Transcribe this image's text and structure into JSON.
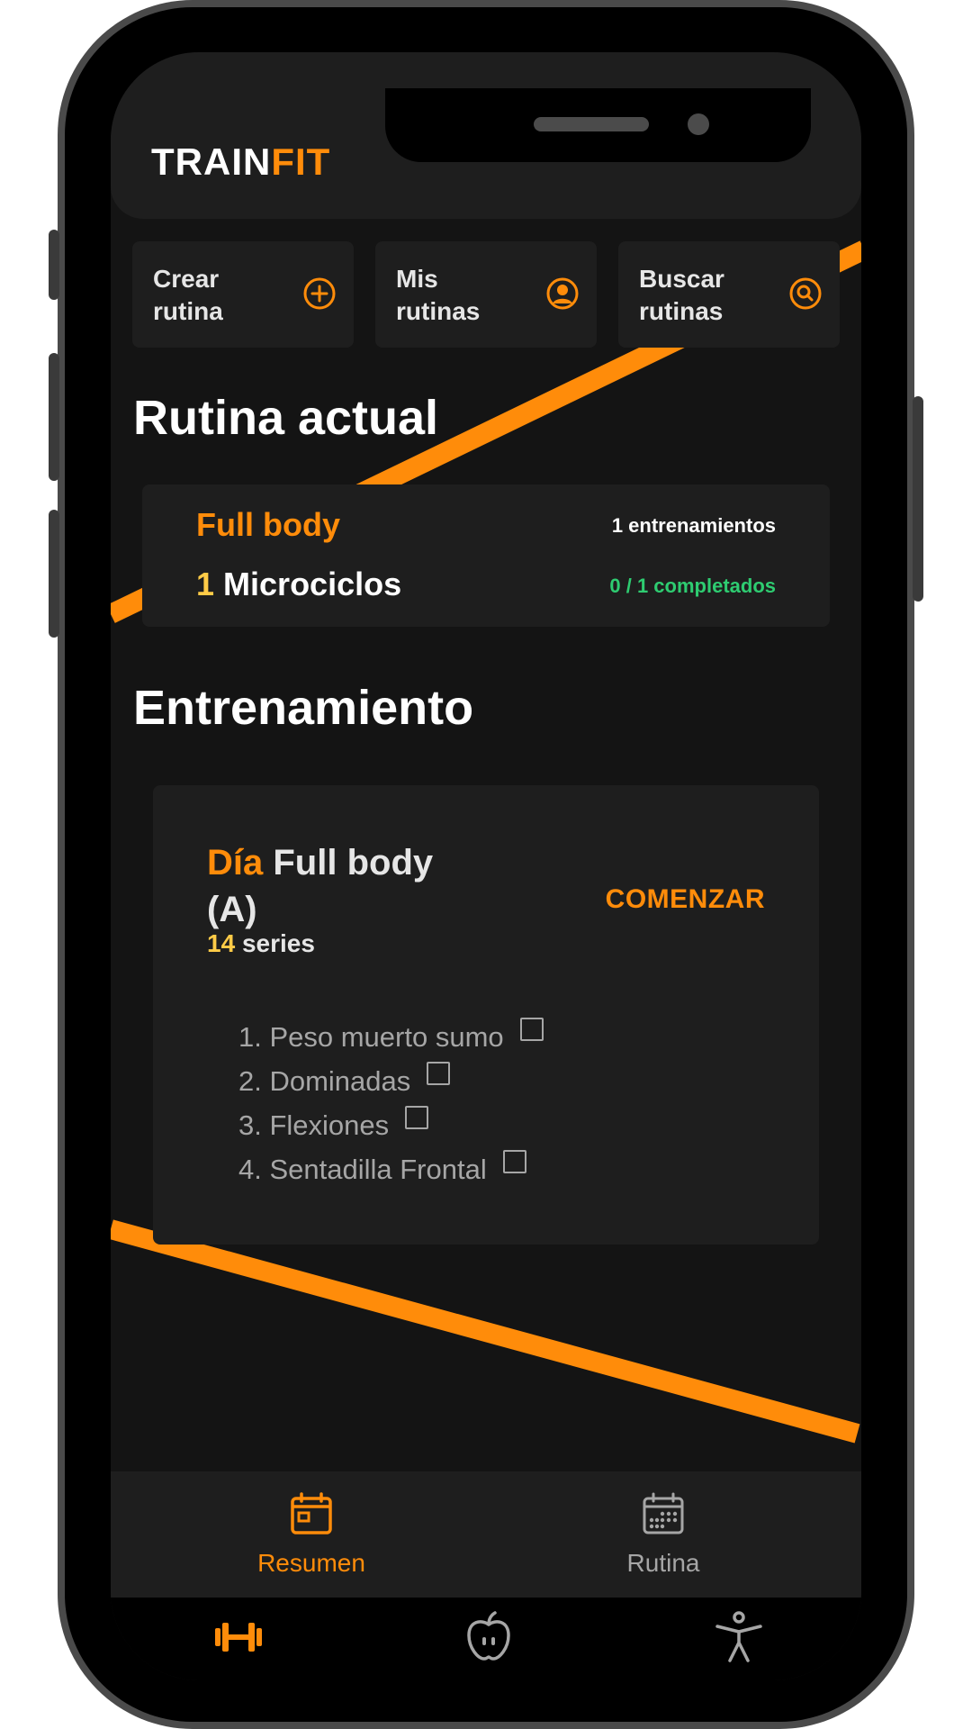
{
  "app": {
    "logo_part1": "TRAIN",
    "logo_part2": "FIT"
  },
  "colors": {
    "accent": "#ff8c0a",
    "success": "#2ecc71",
    "highlight": "#ffcb47",
    "background": "#141414",
    "card": "#1e1e1e"
  },
  "quick_actions": [
    {
      "label": "Crear rutina",
      "icon": "plus-circle-icon"
    },
    {
      "label": "Mis rutinas",
      "icon": "user-circle-icon"
    },
    {
      "label": "Buscar rutinas",
      "icon": "search-circle-icon"
    }
  ],
  "current_routine": {
    "section_title": "Rutina actual",
    "name": "Full body",
    "trainings": "1 entrenamientos",
    "micro_count": "1",
    "micro_label": "Microciclos",
    "completed": "0 / 1 completados"
  },
  "workout": {
    "section_title": "Entrenamiento",
    "day_label": "Día",
    "day_name": "Full body (A)",
    "series_count": "14",
    "series_label": "series",
    "start_label": "COMENZAR",
    "exercises": [
      "1. Peso muerto sumo",
      "2. Dominadas",
      "3. Flexiones",
      "4. Sentadilla Frontal"
    ]
  },
  "tabs": [
    {
      "label": "Resumen",
      "icon": "calendar-icon",
      "active": true
    },
    {
      "label": "Rutina",
      "icon": "calendar-grid-icon",
      "active": false
    }
  ],
  "bottom_nav": [
    {
      "icon": "dumbbell-icon",
      "active": true
    },
    {
      "icon": "apple-icon",
      "active": false
    },
    {
      "icon": "accessibility-icon",
      "active": false
    }
  ]
}
